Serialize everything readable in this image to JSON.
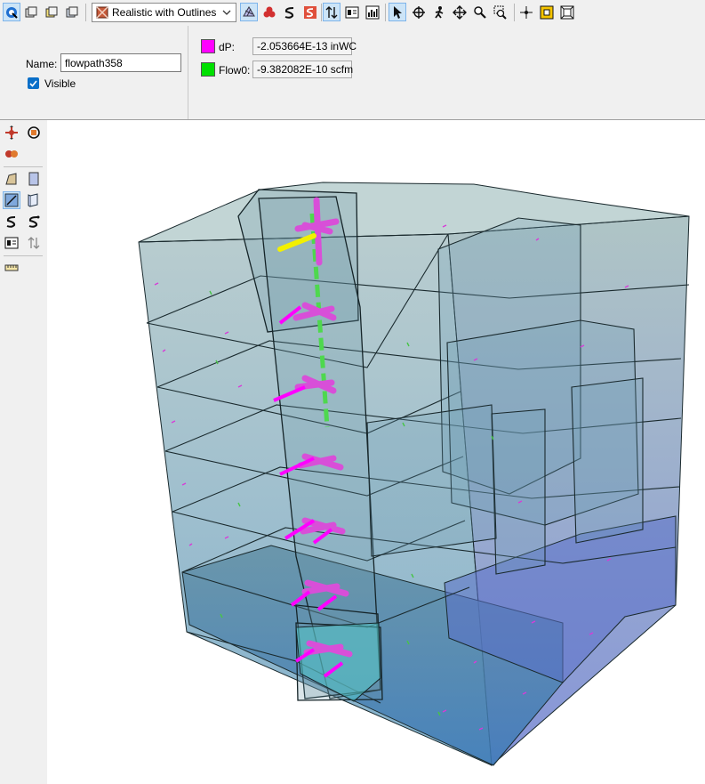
{
  "toolbar": {
    "render_mode": "Realistic with Outlines",
    "icons": [
      "select-view-icon",
      "view-cube-1-icon",
      "view-cube-2-icon",
      "view-cube-3-icon",
      "render-mode-icon",
      "display-grid-icon",
      "display-objects-icon",
      "display-paths-icon",
      "display-results-icon",
      "flow-arrows-icon",
      "legend-icon",
      "chart-icon",
      "pointer-icon",
      "move-icon",
      "walk-icon",
      "pan-icon",
      "zoom-icon",
      "zoom-window-icon",
      "snap-icon",
      "fit-icon",
      "fit-all-icon"
    ]
  },
  "properties": {
    "name_label": "Name:",
    "name_value": "flowpath358",
    "visible_label": "Visible",
    "visible_checked": true
  },
  "results": [
    {
      "label": "dP:",
      "value": "-2.053664E-13 inWC",
      "color": "#ff00ff"
    },
    {
      "label": "Flow0:",
      "value": "-9.382082E-10 scfm",
      "color": "#00e000"
    }
  ],
  "sidebar": {
    "icons": [
      "orbit-icon",
      "rotate-icon",
      "flip-icon",
      "zone-shape-icon",
      "box-icon",
      "wall-toggle-icon",
      "wall-3d-icon",
      "path-icon",
      "path-alt-icon",
      "result-panel-icon",
      "flow-icon",
      "ruler-icon"
    ]
  },
  "viewport": {
    "description_label": "3D building zone view"
  }
}
